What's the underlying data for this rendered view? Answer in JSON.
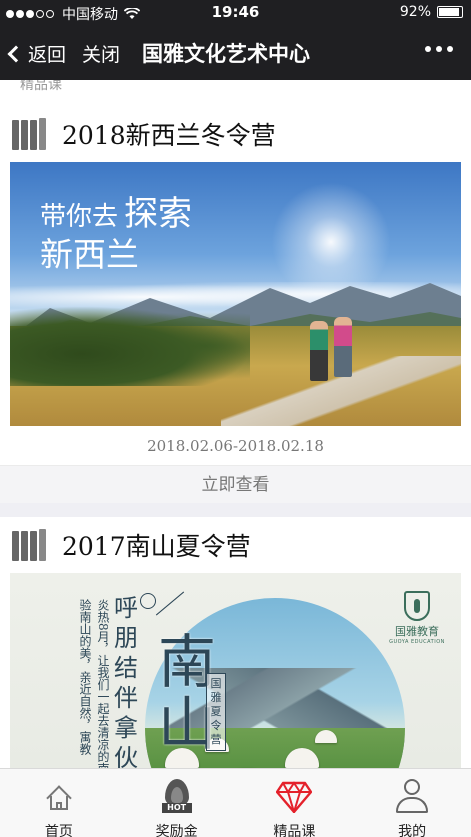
{
  "status_bar": {
    "carrier": "中国移动",
    "time": "19:46",
    "battery": "92%",
    "battery_level": 0.92,
    "signal_bars_filled": 3,
    "signal_bars_total": 5
  },
  "nav": {
    "back_label": "返回",
    "close_label": "关闭",
    "title": "国雅文化艺术中心"
  },
  "section_header": "精品课",
  "cards": [
    {
      "title": "2018新西兰冬令营",
      "image_text_line1": "带你去",
      "image_text_emph": "探索",
      "image_text_line2": "新西兰",
      "date": "2018.02.06-2018.02.18",
      "action": "立即查看"
    },
    {
      "title": "2017南山夏令营",
      "image_big": "南山",
      "image_vertical": "呼朋结伴拿伙",
      "image_verse": "炎热8月，让我们一起去清凉的南山，体验南山的美，亲近自然，寓教",
      "image_tag": "国雅夏令营",
      "logo_name": "国雅教育",
      "logo_en": "GUOYA EDUCATION"
    }
  ],
  "tabs": [
    {
      "label": "首页",
      "icon": "home-icon"
    },
    {
      "label": "奖励金",
      "icon": "hot-flame-icon",
      "badge": "HOT"
    },
    {
      "label": "精品课",
      "icon": "diamond-icon"
    },
    {
      "label": "我的",
      "icon": "user-icon"
    }
  ],
  "colors": {
    "nav_bg": "#1f1f22",
    "accent_red": "#e4212b",
    "page_bg": "#efeff4"
  }
}
